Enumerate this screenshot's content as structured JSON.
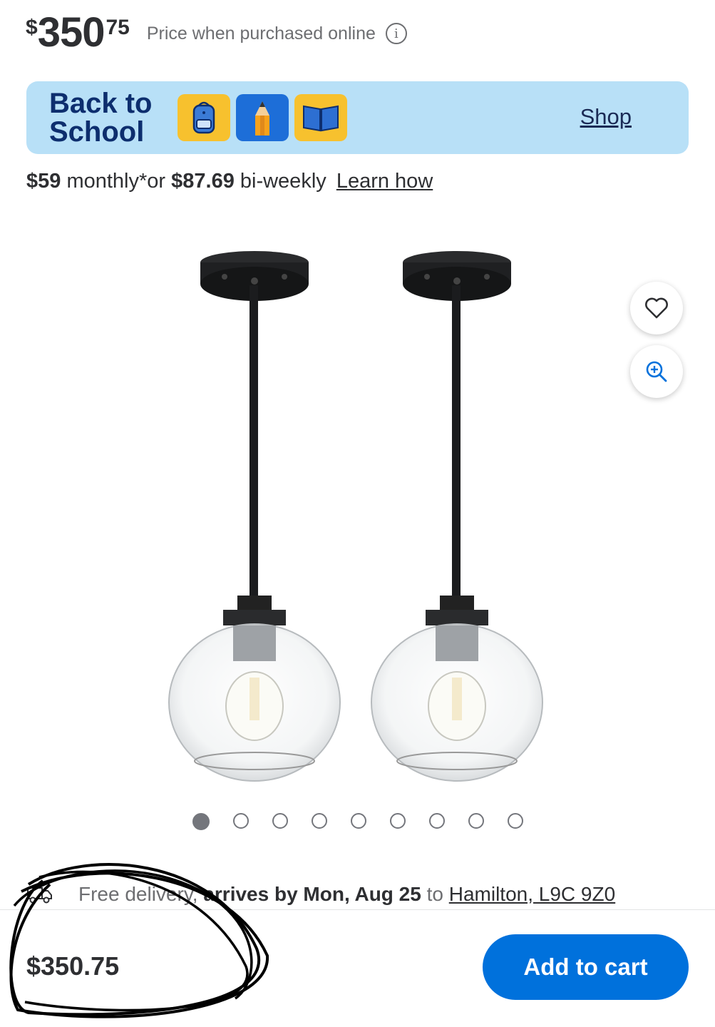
{
  "price": {
    "currency": "$",
    "dollars": "350",
    "cents": "75",
    "note": "Price when purchased online",
    "info_icon": "i"
  },
  "banner": {
    "title_line1": "Back to",
    "title_line2": "School",
    "icons": [
      "backpack-icon",
      "pencil-icon",
      "book-icon"
    ],
    "shop_label": "Shop",
    "background": "#b8e0f7",
    "title_color": "#0d2e6e"
  },
  "financing": {
    "monthly_amount": "$59",
    "monthly_text": " monthly*or ",
    "biweekly_amount": "$87.69",
    "biweekly_text": " bi-weekly ",
    "learn_link": "Learn how"
  },
  "carousel": {
    "total_images": 9,
    "active_index": 0
  },
  "delivery": {
    "prefix": "Free delivery, ",
    "arrives": "arrives by Mon, Aug 25",
    "to": " to ",
    "location": "Hamilton, L9C 9Z0"
  },
  "footer": {
    "price": "$350.75",
    "add_to_cart": "Add to cart",
    "button_color": "#0071dc"
  }
}
